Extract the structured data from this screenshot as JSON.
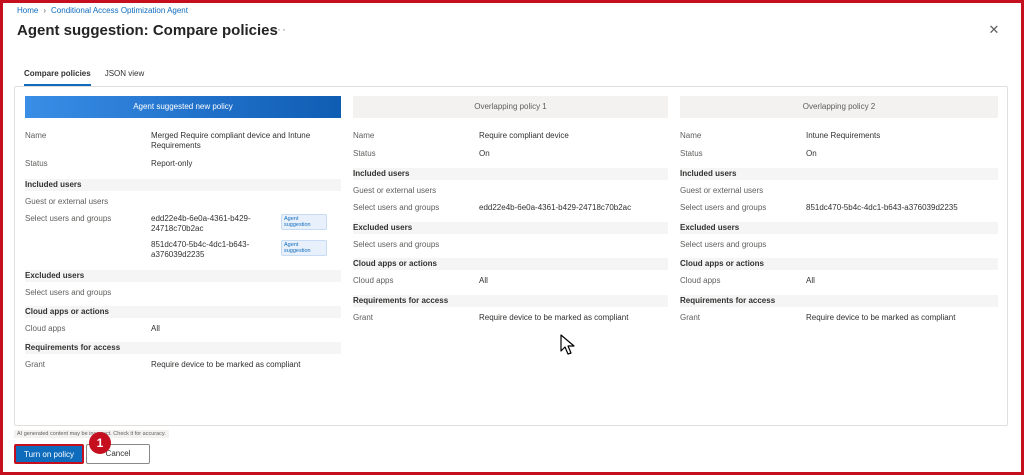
{
  "breadcrumb": {
    "home": "Home",
    "agent": "Conditional Access Optimization Agent"
  },
  "page_title": "Agent suggestion: Compare policies",
  "tabs": [
    {
      "label": "Compare policies",
      "active": true
    },
    {
      "label": "JSON view",
      "active": false
    }
  ],
  "labels": {
    "name": "Name",
    "status": "Status",
    "included_users": "Included users",
    "guest_external": "Guest or external users",
    "select_users_groups": "Select users and groups",
    "excluded_users": "Excluded users",
    "cloud_apps_actions": "Cloud apps or actions",
    "cloud_apps": "Cloud apps",
    "requirements": "Requirements for access",
    "grant": "Grant"
  },
  "columns": [
    {
      "header": "Agent suggested new policy",
      "name": "Merged Require compliant device and Intune Requirements",
      "status": "Report-only",
      "users": [
        {
          "id": "edd22e4b-6e0a-4361-b429-24718c70b2ac",
          "badge": "Agent suggestion"
        },
        {
          "id": "851dc470-5b4c-4dc1-b643-a376039d2235",
          "badge": "Agent suggestion"
        }
      ],
      "cloud_apps": "All",
      "grant": "Require device to be marked as compliant"
    },
    {
      "header": "Overlapping policy 1",
      "name": "Require compliant device",
      "status": "On",
      "users": [
        {
          "id": "edd22e4b-6e0a-4361-b429-24718c70b2ac"
        }
      ],
      "cloud_apps": "All",
      "grant": "Require device to be marked as compliant"
    },
    {
      "header": "Overlapping policy 2",
      "name": "Intune Requirements",
      "status": "On",
      "users": [
        {
          "id": "851dc470-5b4c-4dc1-b643-a376039d2235"
        }
      ],
      "cloud_apps": "All",
      "grant": "Require device to be marked as compliant"
    }
  ],
  "disclaimer": "AI generated content may be incorrect. Check it for accuracy.",
  "footer": {
    "primary": "Turn on policy",
    "secondary": "Cancel"
  },
  "step_marker": "1",
  "icons": {
    "close": "close-icon",
    "more": "more-icon",
    "chevron": "chevron-right-icon",
    "cursor": "mouse-cursor-icon"
  },
  "colors": {
    "accent": "#0f6cbd",
    "annotation_red": "#c50f1f"
  }
}
